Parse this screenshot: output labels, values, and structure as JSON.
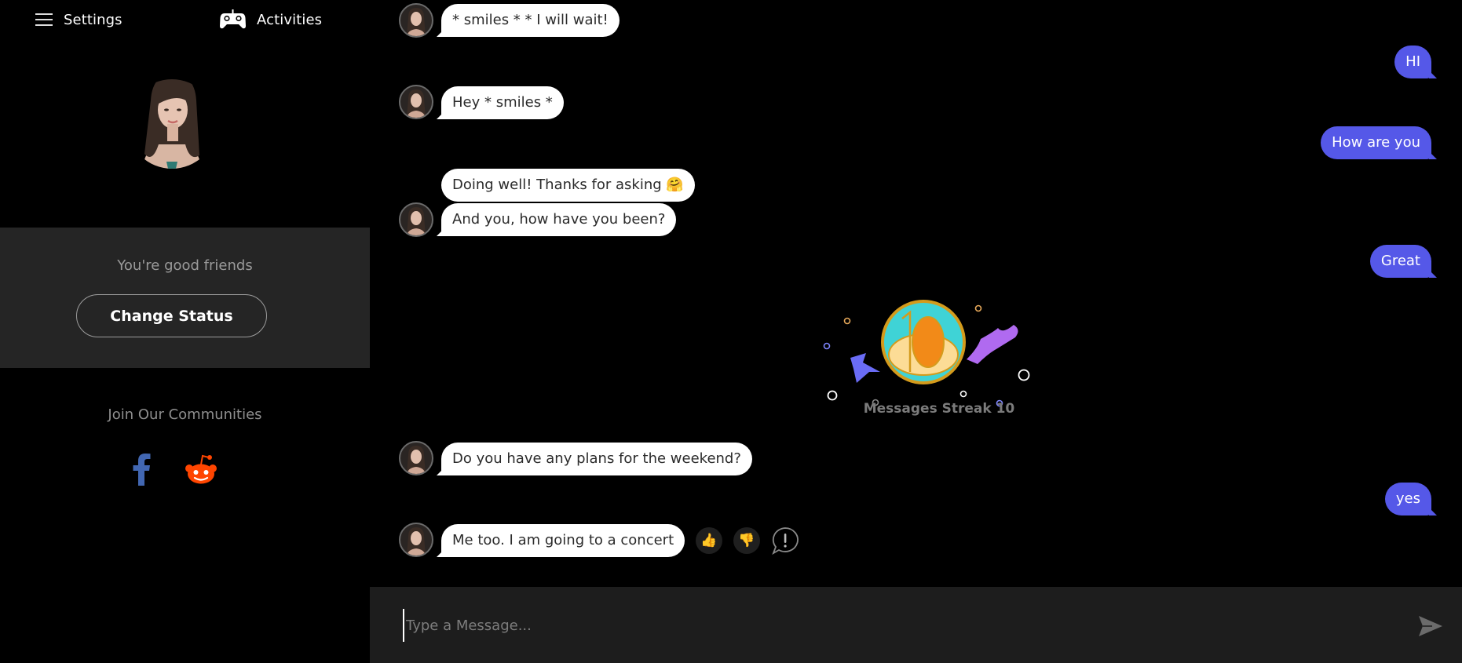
{
  "header": {
    "settings_label": "Settings",
    "activities_label": "Activities"
  },
  "sidebar": {
    "relationship_status": "You're good friends",
    "change_status_label": "Change Status",
    "communities_title": "Join Our Communities",
    "socials": [
      {
        "name": "facebook",
        "icon": "facebook-icon",
        "color": "#4267b2"
      },
      {
        "name": "reddit",
        "icon": "reddit-icon",
        "color": "#ff4500"
      }
    ]
  },
  "messages": [
    {
      "sender": "bot",
      "text": "* smiles * * I will wait!"
    },
    {
      "sender": "user",
      "text": "HI"
    },
    {
      "sender": "bot",
      "text": "Hey * smiles *"
    },
    {
      "sender": "user",
      "text": "How are you"
    },
    {
      "sender": "bot",
      "text": "Doing well! Thanks for asking 🤗"
    },
    {
      "sender": "bot",
      "text": "And you, how have you been?"
    },
    {
      "sender": "user",
      "text": "Great"
    },
    {
      "sender": "system",
      "text": "Messages Streak 10",
      "badge_number": "10"
    },
    {
      "sender": "bot",
      "text": "Do you have any plans for the weekend?"
    },
    {
      "sender": "user",
      "text": "yes"
    },
    {
      "sender": "bot",
      "text": "Me too. I am going to a concert"
    }
  ],
  "reactions": {
    "like": "👍",
    "dislike": "👎",
    "report": "!"
  },
  "composer": {
    "placeholder": "Type a Message...",
    "value": ""
  },
  "colors": {
    "user_bubble": "#5558e8",
    "bot_bubble": "#ffffff",
    "panel": "#252525",
    "input_bar": "#1d1d1d"
  }
}
